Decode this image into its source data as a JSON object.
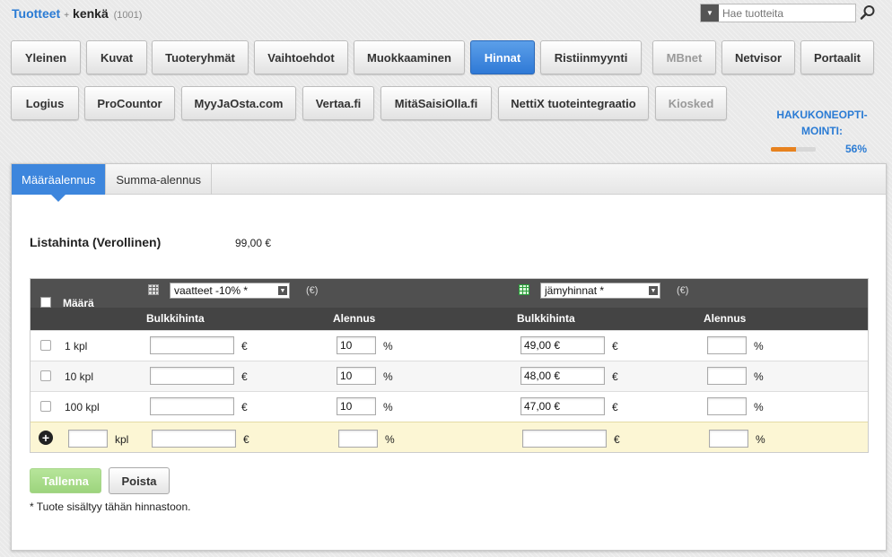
{
  "breadcrumb": {
    "root": "Tuotteet",
    "separator": "+",
    "current": "kenkä",
    "count": "(1001)"
  },
  "search": {
    "placeholder": "Hae tuotteita"
  },
  "nav": {
    "row1": [
      "Yleinen",
      "Kuvat",
      "Tuoteryhmät",
      "Vaihtoehdot",
      "Muokkaaminen",
      "Hinnat",
      "Ristiinmyynti",
      "MBnet",
      "Netvisor",
      "Portaalit"
    ],
    "row2": [
      "Logius",
      "ProCountor",
      "MyyJaOsta.com",
      "Vertaa.fi",
      "MitäSaisiOlla.fi",
      "NettiX tuoteintegraatio",
      "Kiosked"
    ],
    "active": "Hinnat",
    "disabled": [
      "MBnet",
      "Kiosked"
    ]
  },
  "seo": {
    "label_line1": "HAKUKONEOPTI-",
    "label_line2": "MOINTI:",
    "percent_text": "56%",
    "progress": 0.56
  },
  "subtabs": [
    "Määräalennus",
    "Summa-alennus"
  ],
  "list_price": {
    "label": "Listahinta (Verollinen)",
    "value": "99,00 €"
  },
  "table": {
    "header_qty": "Määrä",
    "group1": {
      "select": "vaatteet -10% *",
      "unit": "(€)",
      "col_price": "Bulkkihinta",
      "col_discount": "Alennus"
    },
    "group2": {
      "select": "jämyhinnat *",
      "unit": "(€)",
      "col_price": "Bulkkihinta",
      "col_discount": "Alennus"
    },
    "rows": [
      {
        "qty": "1 kpl",
        "g1_price": "",
        "g1_discount": "10",
        "g2_price": "49,00 €",
        "g2_discount": ""
      },
      {
        "qty": "10 kpl",
        "g1_price": "",
        "g1_discount": "10",
        "g2_price": "48,00 €",
        "g2_discount": ""
      },
      {
        "qty": "100 kpl",
        "g1_price": "",
        "g1_discount": "10",
        "g2_price": "47,00 €",
        "g2_discount": ""
      }
    ],
    "add_row": {
      "qty_unit": "kpl"
    },
    "currency_symbol": "€",
    "percent_symbol": "%"
  },
  "buttons": {
    "save": "Tallenna",
    "delete": "Poista"
  },
  "footnote": "* Tuote sisältyy tähän hinnastoon.",
  "colors": {
    "accent": "#2a7bd4",
    "active_tab": "#3d86dd",
    "progress": "#e7821f",
    "save_button": "#9dd47d",
    "add_row": "#fcf6d4"
  }
}
